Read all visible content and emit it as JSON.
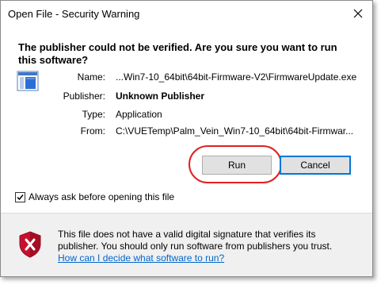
{
  "window": {
    "title": "Open File - Security Warning"
  },
  "heading": "The publisher could not be verified.  Are you sure you want to run this software?",
  "details": {
    "name_label": "Name:",
    "name_value": "...Win7-10_64bit\\64bit-Firmware-V2\\FirmwareUpdate.exe",
    "publisher_label": "Publisher:",
    "publisher_value": "Unknown Publisher",
    "type_label": "Type:",
    "type_value": "Application",
    "from_label": "From:",
    "from_value": "C:\\VUETemp\\Palm_Vein_Win7-10_64bit\\64bit-Firmwar..."
  },
  "buttons": {
    "run": "Run",
    "cancel": "Cancel"
  },
  "checkbox": {
    "label": "Always ask before opening this file",
    "checked": true
  },
  "footer": {
    "line1": "This file does not have a valid digital signature that verifies its",
    "line2": "publisher.  You should only run software from publishers you trust.",
    "link": "How can I decide what software to run?"
  },
  "colors": {
    "highlight": "#e02020",
    "link": "#0066cc",
    "shield": "#c8102e"
  },
  "icons": {
    "close": "close-icon",
    "file": "application-file-icon",
    "warning": "security-shield-icon",
    "check": "checkmark-icon"
  }
}
